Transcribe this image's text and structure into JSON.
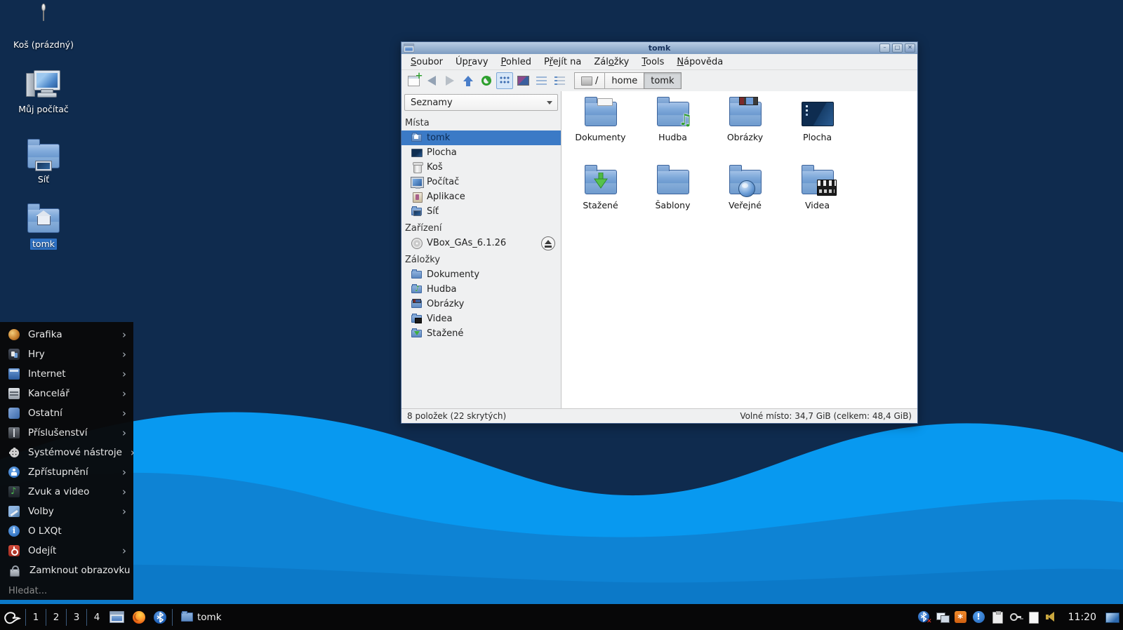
{
  "colors": {
    "desktop_bg": "#0f2b4e",
    "wave_bright": "#0899f0",
    "wave_mid": "#0e83d4",
    "selection_blue": "#2f72c4",
    "titlebar_top": "#b9cde4",
    "titlebar_bottom": "#7d9cc1",
    "window_chrome": "#eff0f1",
    "menu_panel": "#09090a",
    "taskbar": "#070708"
  },
  "desktop": {
    "icons": [
      {
        "label": "Koš (prázdný)",
        "icon": "trash-icon"
      },
      {
        "label": "Můj počítač",
        "icon": "computer-icon"
      },
      {
        "label": "Síť",
        "icon": "network-folder-icon"
      },
      {
        "label": "tomk",
        "icon": "home-folder-icon",
        "selected": true
      }
    ]
  },
  "start_menu": {
    "items": [
      {
        "label": "Grafika",
        "icon": "graphics-icon",
        "submenu": true
      },
      {
        "label": "Hry",
        "icon": "games-icon",
        "submenu": true
      },
      {
        "label": "Internet",
        "icon": "internet-icon",
        "submenu": true
      },
      {
        "label": "Kancelář",
        "icon": "office-icon",
        "submenu": true
      },
      {
        "label": "Ostatní",
        "icon": "other-icon",
        "submenu": true
      },
      {
        "label": "Příslušenství",
        "icon": "accessories-icon",
        "submenu": true
      },
      {
        "label": "Systémové nástroje",
        "icon": "system-tools-icon",
        "submenu": true
      },
      {
        "label": "Zpřístupnění",
        "icon": "accessibility-icon",
        "submenu": true
      },
      {
        "label": "Zvuk a video",
        "icon": "multimedia-icon",
        "submenu": true
      },
      {
        "label": "Volby",
        "icon": "preferences-icon",
        "submenu": true
      },
      {
        "label": "O LXQt",
        "icon": "about-icon",
        "submenu": false
      },
      {
        "label": "Odejít",
        "icon": "leave-icon",
        "submenu": true
      },
      {
        "label": "Zamknout obrazovku",
        "icon": "lock-screen-icon",
        "submenu": false
      }
    ],
    "search_placeholder": "Hledat..."
  },
  "window": {
    "title": "tomk",
    "menubar": [
      {
        "label": "Soubor",
        "accel": 0
      },
      {
        "label": "Úpravy",
        "accel": 2
      },
      {
        "label": "Pohled",
        "accel": 0
      },
      {
        "label": "Přejít na",
        "accel": 1
      },
      {
        "label": "Záložky",
        "accel": 3
      },
      {
        "label": "Tools",
        "accel": 0
      },
      {
        "label": "Nápověda",
        "accel": 0
      }
    ],
    "toolbar_buttons": [
      "new-tab",
      "back",
      "forward",
      "up",
      "refresh",
      "icon-view",
      "thumbnail-view",
      "compact-view",
      "detailed-list-view"
    ],
    "path": {
      "segments": [
        "/",
        "home",
        "tomk"
      ],
      "active": "tomk"
    },
    "sidebar": {
      "view_selector": "Seznamy",
      "sections": [
        {
          "title": "Místa",
          "items": [
            {
              "label": "tomk",
              "icon": "user-home-icon",
              "selected": true
            },
            {
              "label": "Plocha",
              "icon": "desktop-icon"
            },
            {
              "label": "Koš",
              "icon": "trash-icon"
            },
            {
              "label": "Počítač",
              "icon": "computer-icon"
            },
            {
              "label": "Aplikace",
              "icon": "applications-icon"
            },
            {
              "label": "Síť",
              "icon": "network-icon"
            }
          ]
        },
        {
          "title": "Zařízení",
          "items": [
            {
              "label": "VBox_GAs_6.1.26",
              "icon": "optical-disc-icon",
              "ejectable": true
            }
          ]
        },
        {
          "title": "Záložky",
          "items": [
            {
              "label": "Dokumenty",
              "icon": "folder-documents-icon"
            },
            {
              "label": "Hudba",
              "icon": "folder-music-icon"
            },
            {
              "label": "Obrázky",
              "icon": "folder-pictures-icon"
            },
            {
              "label": "Videa",
              "icon": "folder-videos-icon"
            },
            {
              "label": "Stažené",
              "icon": "folder-downloads-icon"
            }
          ]
        }
      ]
    },
    "files": [
      {
        "label": "Dokumenty",
        "emblem": "documents"
      },
      {
        "label": "Hudba",
        "emblem": "music"
      },
      {
        "label": "Obrázky",
        "emblem": "pictures"
      },
      {
        "label": "Plocha",
        "emblem": "screen"
      },
      {
        "label": "Stažené",
        "emblem": "downloads"
      },
      {
        "label": "Šablony",
        "emblem": "none"
      },
      {
        "label": "Veřejné",
        "emblem": "globe"
      },
      {
        "label": "Videa",
        "emblem": "video"
      }
    ],
    "statusbar": {
      "items": "8 položek (22 skrytých)",
      "free_space": "Volné místo: 34,7 GiB (celkem: 48,4 GiB)"
    }
  },
  "taskbar": {
    "workspaces": [
      "1",
      "2",
      "3",
      "4"
    ],
    "quick_launch": [
      "file-manager-icon",
      "firefox-icon",
      "bluetooth-icon"
    ],
    "task_button": {
      "label": "tomk",
      "icon": "folder-icon"
    },
    "tray": [
      "bluetooth-disabled-icon",
      "network-tray-icon",
      "updates-tray-icon",
      "notification-tray-icon",
      "clipboard-tray-icon",
      "key-tray-icon",
      "notes-tray-icon",
      "volume-tray-icon"
    ],
    "clock": "11:20",
    "show_desktop": "show-desktop-icon"
  }
}
